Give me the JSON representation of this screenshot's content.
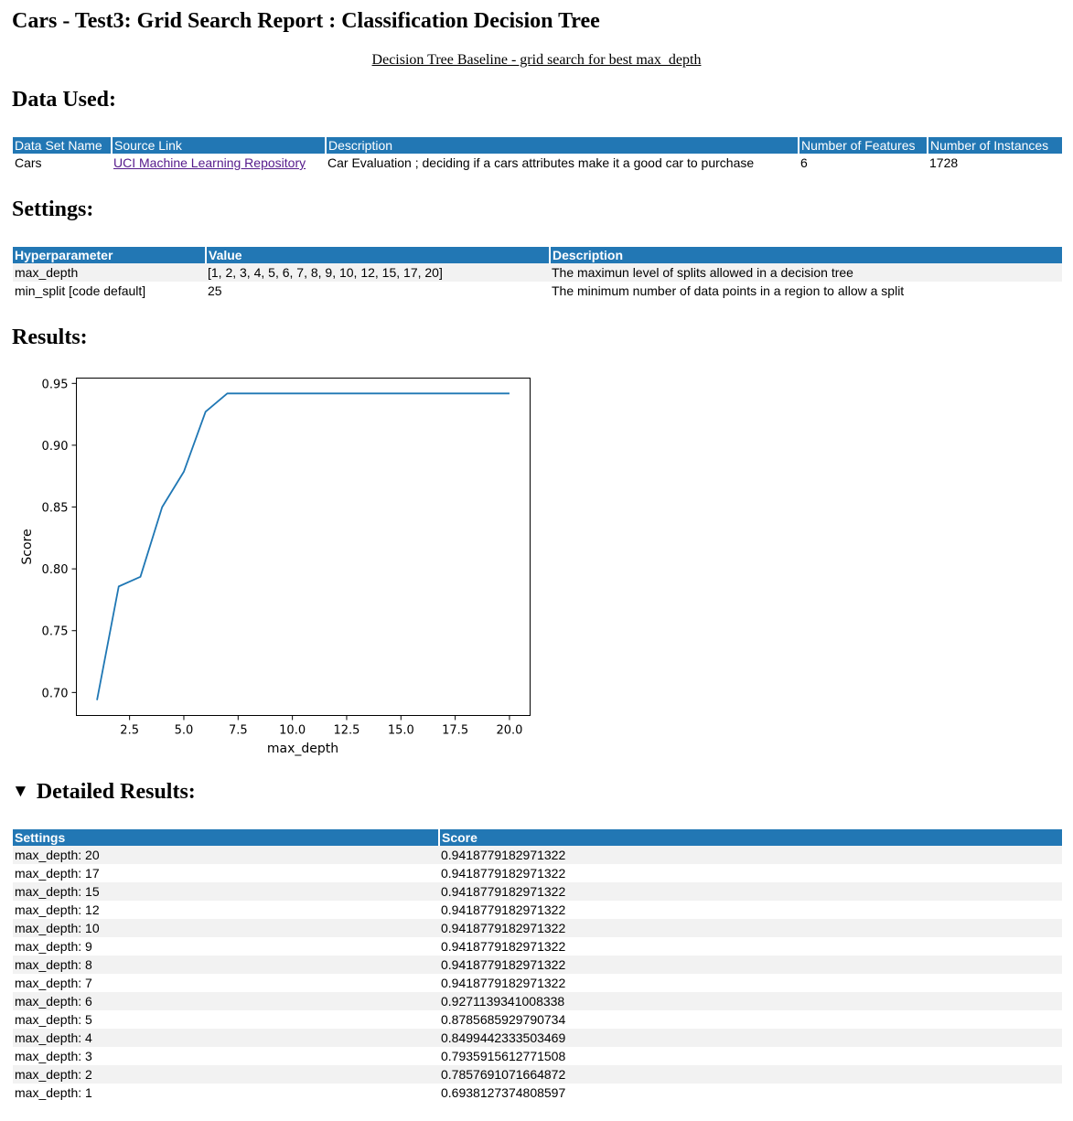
{
  "page": {
    "title": "Cars - Test3: Grid Search Report : Classification Decision Tree",
    "subtitle": "Decision Tree Baseline - grid search for best max_depth"
  },
  "sections": {
    "data_used": "Data Used:",
    "settings": "Settings:",
    "results": "Results:",
    "detailed": "Detailed Results:"
  },
  "data_table": {
    "headers": [
      "Data Set Name",
      "Source Link",
      "Description",
      "Number of Features",
      "Number of Instances"
    ],
    "row": {
      "name": "Cars",
      "source": "UCI Machine Learning Repository",
      "description": "Car Evaluation ; deciding if a cars attributes make it a good car to purchase",
      "features": "6",
      "instances": "1728"
    }
  },
  "settings_table": {
    "headers": [
      "Hyperparameter",
      "Value",
      "Description"
    ],
    "rows": [
      {
        "param": "max_depth",
        "value": "[1, 2, 3, 4, 5, 6, 7, 8, 9, 10, 12, 15, 17, 20]",
        "description": "The maximun level of splits allowed in a decision tree"
      },
      {
        "param": "min_split [code default]",
        "value": "25",
        "description": "The minimum number of data points in a region to allow a split"
      }
    ]
  },
  "detailed_table": {
    "headers": [
      "Settings",
      "Score"
    ],
    "rows": [
      {
        "setting": "max_depth: 20",
        "score": "0.9418779182971322"
      },
      {
        "setting": "max_depth: 17",
        "score": "0.9418779182971322"
      },
      {
        "setting": "max_depth: 15",
        "score": "0.9418779182971322"
      },
      {
        "setting": "max_depth: 12",
        "score": "0.9418779182971322"
      },
      {
        "setting": "max_depth: 10",
        "score": "0.9418779182971322"
      },
      {
        "setting": "max_depth: 9",
        "score": "0.9418779182971322"
      },
      {
        "setting": "max_depth: 8",
        "score": "0.9418779182971322"
      },
      {
        "setting": "max_depth: 7",
        "score": "0.9418779182971322"
      },
      {
        "setting": "max_depth: 6",
        "score": "0.9271139341008338"
      },
      {
        "setting": "max_depth: 5",
        "score": "0.8785685929790734"
      },
      {
        "setting": "max_depth: 4",
        "score": "0.8499442333503469"
      },
      {
        "setting": "max_depth: 3",
        "score": "0.7935915612771508"
      },
      {
        "setting": "max_depth: 2",
        "score": "0.7857691071664872"
      },
      {
        "setting": "max_depth: 1",
        "score": "0.6938127374808597"
      }
    ]
  },
  "colors": {
    "header_bg": "#2277b4",
    "stripe_bg": "#f2f2f2",
    "line": "#1f77b4",
    "link": "#551a8b"
  },
  "chart_data": {
    "type": "line",
    "title": "",
    "xlabel": "max_depth",
    "ylabel": "Score",
    "x": [
      1,
      2,
      3,
      4,
      5,
      6,
      7,
      8,
      9,
      10,
      12,
      15,
      17,
      20
    ],
    "y": [
      0.6938127374808597,
      0.7857691071664872,
      0.7935915612771508,
      0.8499442333503469,
      0.8785685929790734,
      0.9271139341008338,
      0.9418779182971322,
      0.9418779182971322,
      0.9418779182971322,
      0.9418779182971322,
      0.9418779182971322,
      0.9418779182971322,
      0.9418779182971322,
      0.9418779182971322
    ],
    "xticks": [
      "2.5",
      "5.0",
      "7.5",
      "10.0",
      "12.5",
      "15.0",
      "17.5",
      "20.0"
    ],
    "yticks": [
      "0.70",
      "0.75",
      "0.80",
      "0.85",
      "0.90",
      "0.95"
    ],
    "xlim": [
      0.05,
      20.95
    ],
    "ylim": [
      0.6814,
      0.9543
    ],
    "grid": false,
    "legend": "none"
  }
}
